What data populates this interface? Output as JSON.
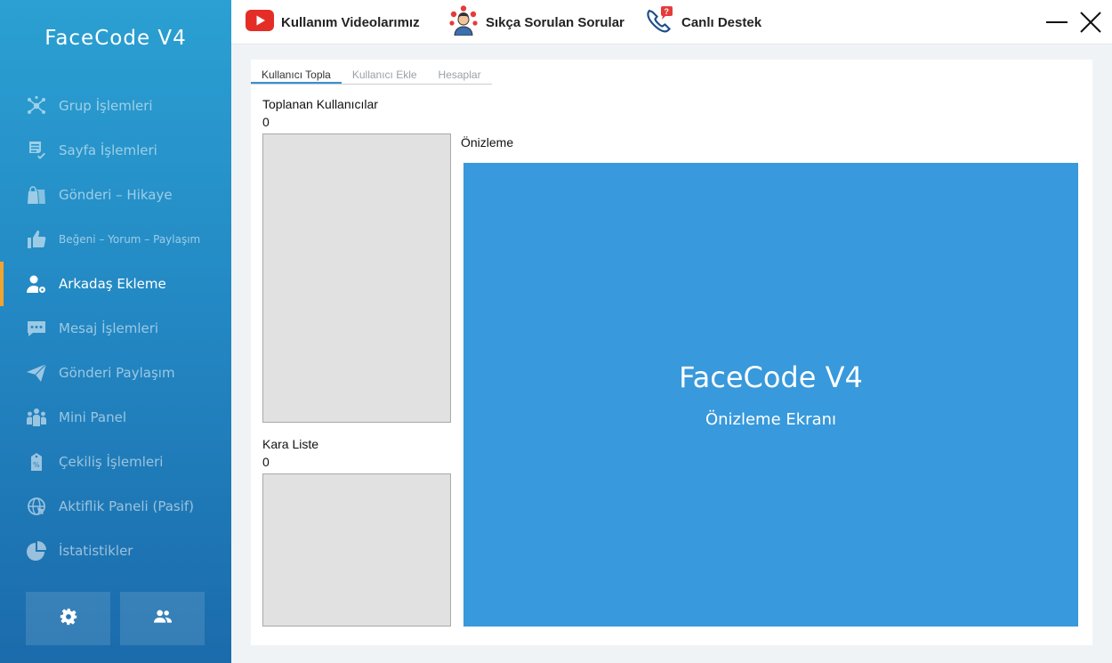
{
  "app": {
    "brand": "FaceCode V4"
  },
  "sidebar": {
    "items": [
      {
        "label": "Grup İşlemleri",
        "icon": "hub-icon"
      },
      {
        "label": "Sayfa İşlemleri",
        "icon": "document-check-icon"
      },
      {
        "label": "Gönderi – Hikaye",
        "icon": "shopping-bags-icon"
      },
      {
        "label": "Beğeni – Yorum – Paylaşım",
        "icon": "thumbs-up-icon"
      },
      {
        "label": "Arkadaş Ekleme",
        "icon": "user-gear-icon",
        "active": true
      },
      {
        "label": "Mesaj İşlemleri",
        "icon": "chat-icon"
      },
      {
        "label": "Gönderi Paylaşım",
        "icon": "paper-plane-icon"
      },
      {
        "label": "Mini Panel",
        "icon": "group-icon"
      },
      {
        "label": "Çekiliş İşlemleri",
        "icon": "discount-tag-icon"
      },
      {
        "label": "Aktiflik Paneli (Pasif)",
        "icon": "globe-cursor-icon"
      },
      {
        "label": "İstatistikler",
        "icon": "pie-chart-icon"
      }
    ],
    "bottom_buttons": [
      {
        "icon": "gear-icon"
      },
      {
        "icon": "users-icon"
      }
    ]
  },
  "topbar": {
    "videos_label": "Kullanım Videolarımız",
    "faq_label": "Sıkça Sorulan Sorular",
    "support_label": "Canlı Destek",
    "accent": "#e52d27"
  },
  "tabs": [
    "Kullanıcı Topla",
    "Kullanıcı Ekle",
    "Hesaplar"
  ],
  "main": {
    "collected_label": "Toplanan Kullanıcılar",
    "collected_count": "0",
    "blacklist_label": "Kara Liste",
    "blacklist_count": "0",
    "preview_label": "Önizleme",
    "preview_title": "FaceCode V4",
    "preview_subtitle": "Önizleme Ekranı",
    "preview_color": "#3899dc"
  }
}
